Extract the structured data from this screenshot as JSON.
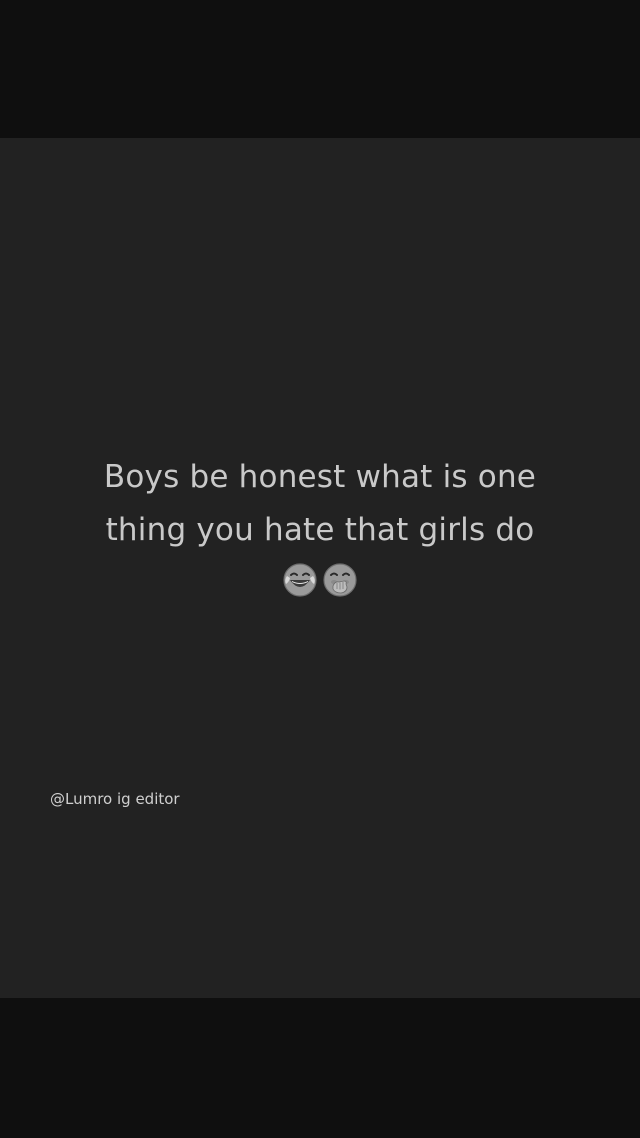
{
  "post": {
    "line1": "Boys be honest what is one",
    "line2": "thing you hate that girls do"
  },
  "emojis": [
    "tears-of-joy-icon",
    "hand-over-mouth-icon"
  ],
  "credit": "@Lumro ig editor",
  "colors": {
    "letterbox": "#0f0f0f",
    "background": "#222222",
    "text": "#c9c9c9"
  }
}
